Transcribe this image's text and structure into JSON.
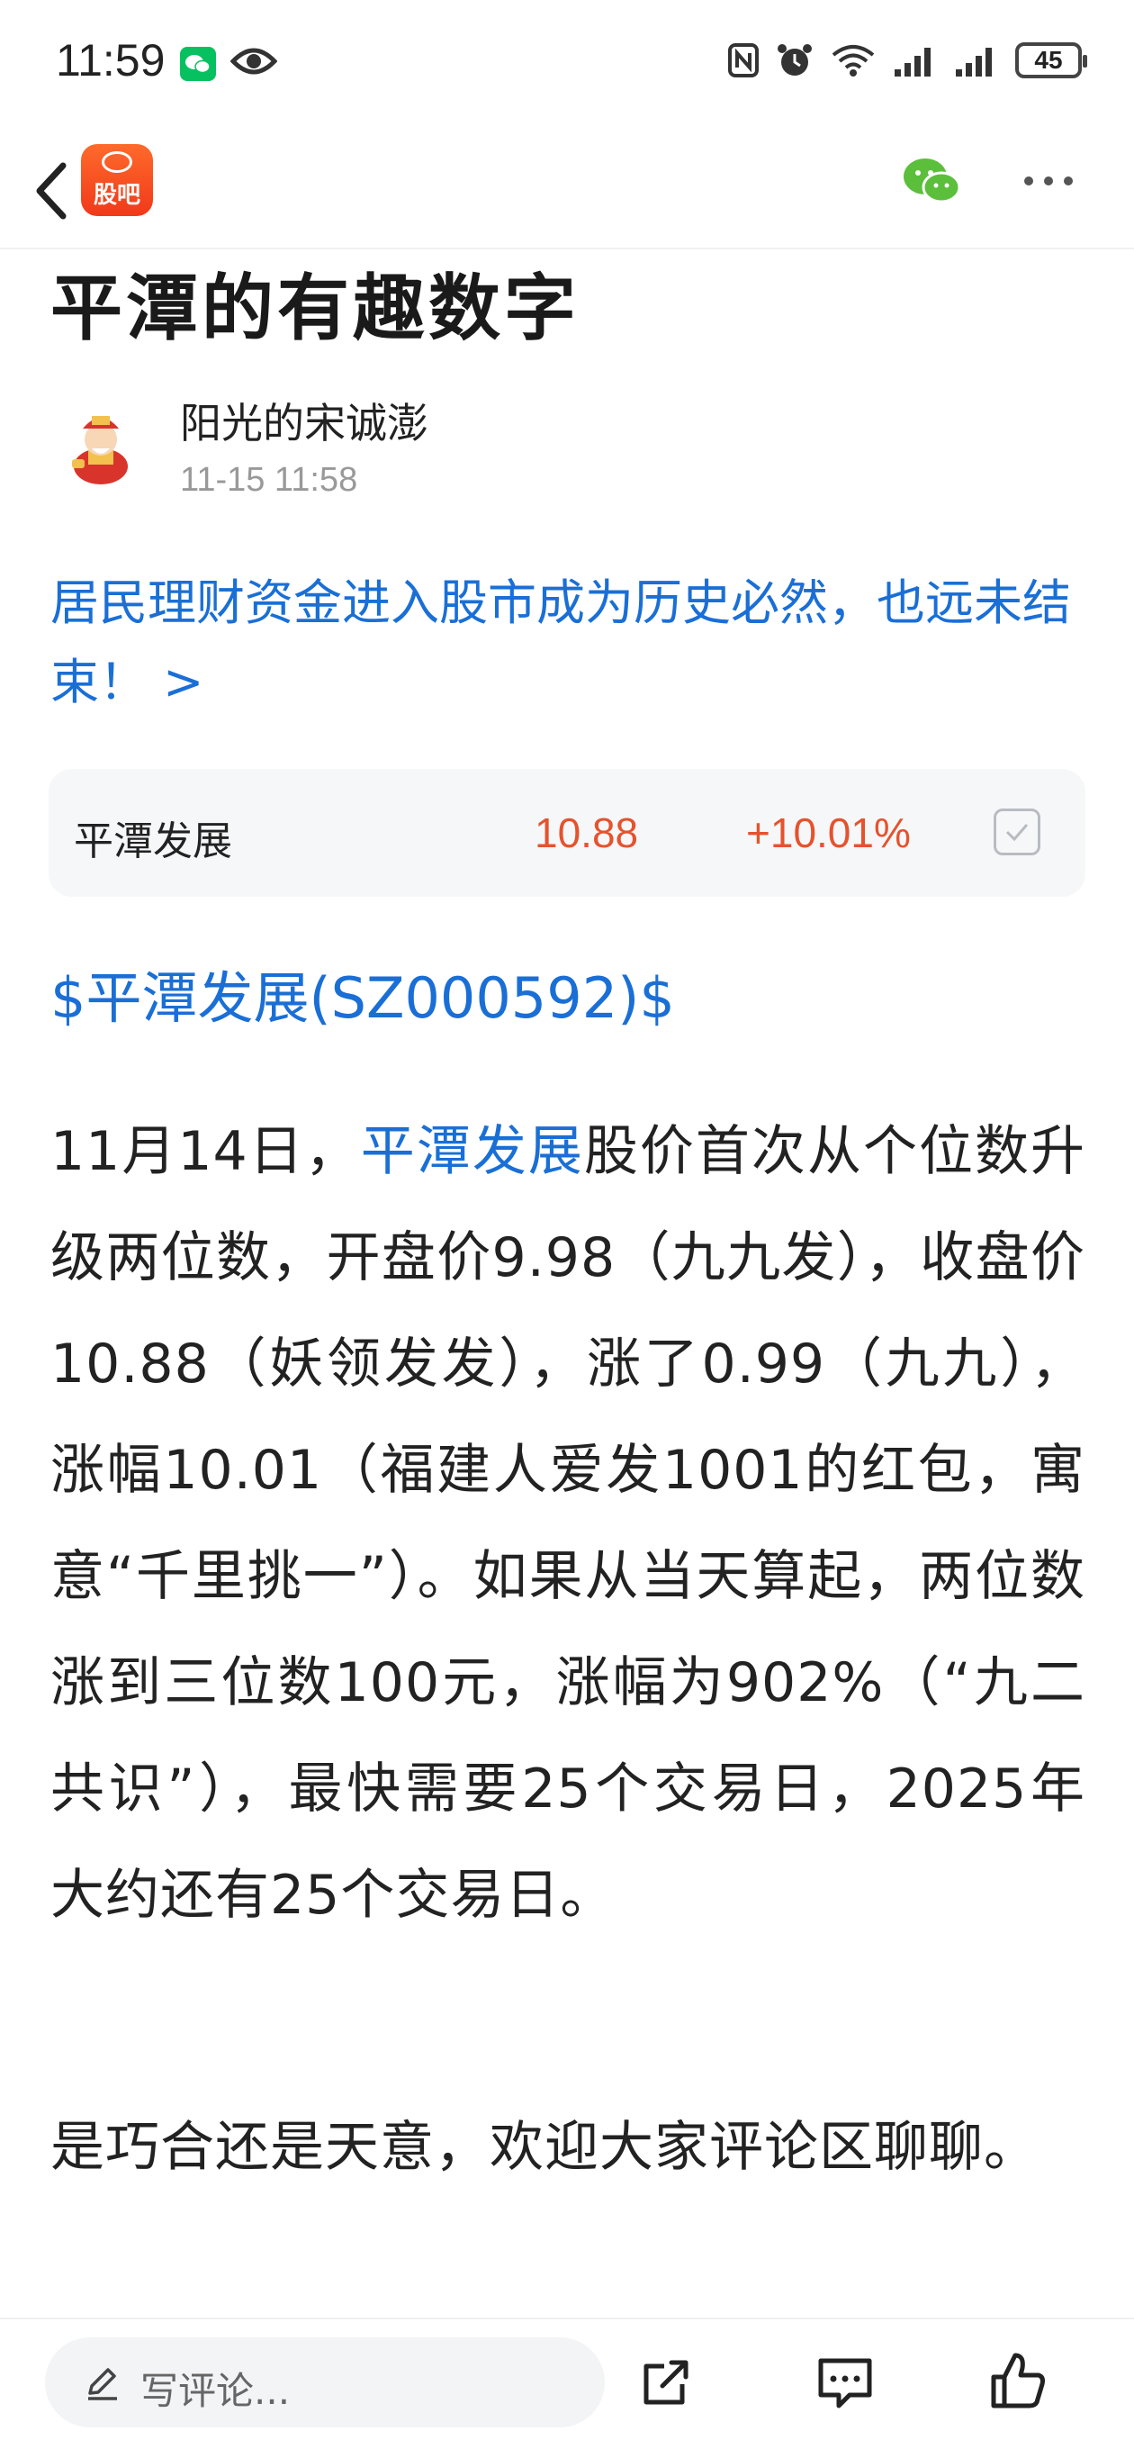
{
  "status_bar": {
    "time": "11:59",
    "battery": "45",
    "icons": [
      "wechat-icon",
      "eye-icon",
      "nfc-icon",
      "alarm-icon",
      "wifi-icon",
      "signal-icon",
      "signal-icon",
      "battery-icon"
    ]
  },
  "nav": {
    "app_logo_text": "股吧",
    "icons": [
      "back-icon",
      "wechat-share-icon",
      "more-icon"
    ]
  },
  "article": {
    "title": "平潭的有趣数字",
    "author": "阳光的宋诚澎",
    "time": "11-15 11:58",
    "headline_link": "居民理财资金进入股市成为历史必然，也远未结束！ >",
    "stock": {
      "name": "平潭发展",
      "price": "10.88",
      "change": "+10.01%"
    },
    "stock_tag": "$平潭发展(SZ000592)$",
    "para1_prefix": "11月14日，",
    "para1_link": "平潭发展",
    "para1_rest": "股价首次从个位数升级两位数，开盘价9.98（九九发），收盘价10.88（妖领发发），涨了0.99（九九），涨幅10.01（福建人爱发1001的红包，寓意“千里挑一”）。如果从当天算起，两位数涨到三位数100元，涨幅为902%（“九二共识”），最快需要25个交易日，2025年大约还有25个交易日。",
    "para2": "是巧合还是天意，欢迎大家评论区聊聊。"
  },
  "bottom_bar": {
    "comment_placeholder": "写评论..."
  },
  "colors": {
    "link": "#1a6fd6",
    "up": "#e5532d",
    "brand": "#f0391a"
  }
}
